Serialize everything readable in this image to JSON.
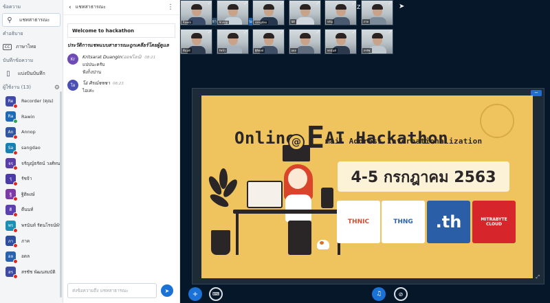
{
  "nav": {
    "section_messages": "ข้อความ",
    "public_chat": "แชทสาธารณะ",
    "section_captions": "คำอธิบาย",
    "language_thai": "ภาษาไทย",
    "section_notes": "บันทึกข้อความ",
    "shared_notes": "แบ่งปันบันทึก",
    "section_users": "ผู้ใช้งาน (13)"
  },
  "users": [
    {
      "initials": "Re",
      "name": "Recorder (คุณ)",
      "color": "#3e49a8",
      "status": "red"
    },
    {
      "initials": "Ra",
      "name": "Rawin",
      "color": "#1c6ab8",
      "status": "green"
    },
    {
      "initials": "An",
      "name": "Annop",
      "color": "#2f55a3",
      "status": "red"
    },
    {
      "initials": "Sa",
      "name": "sangdao",
      "color": "#1680b3",
      "status": "red"
    },
    {
      "initials": "จร",
      "name": "จรัญญ์ธรัตน์ วงศ์ทนท์...",
      "color": "#5a3ea8",
      "status": "red"
    },
    {
      "initials": "รุ",
      "name": "รัชจ้า",
      "color": "#4c3aa6",
      "status": "red"
    },
    {
      "initials": "ฐิ",
      "name": "ฐิติพงษ์",
      "color": "#7b3aa6",
      "status": "red"
    },
    {
      "initials": "ดิ",
      "name": "ดีนนท์",
      "color": "#5c3fb0",
      "status": "red"
    },
    {
      "initials": "พร",
      "name": "พรนันท์ รัตนโรจน์พันธ์",
      "color": "#1c8fb5",
      "status": "red"
    },
    {
      "initials": "ภา",
      "name": "ภาค",
      "color": "#2d4e9e",
      "status": "red"
    },
    {
      "initials": "อล",
      "name": "อดล",
      "color": "#2863b0",
      "status": "red"
    },
    {
      "initials": "สร",
      "name": "สรชัช พัฒนสมบัติ",
      "color": "#3c4aa1",
      "status": "red"
    }
  ],
  "chat": {
    "header": "แชทสาธารณะ",
    "welcome": "Welcome to hackathon",
    "announcement": "ประวัติการแชทแบบสาธารณะถูกเคลียร์โดยผู้ดูแล",
    "messages": [
      {
        "initials": "Kr",
        "avatar_color": "#6f4bb5",
        "name": "Kritsarat Duangin",
        "sub": "(ออฟไลน์)",
        "time": "08:21",
        "lines": [
          "แปปนะครับ",
          "ฟังก็งปาน"
        ]
      },
      {
        "initials": "โอ",
        "avatar_color": "#4a4fb3",
        "name": "โอ่ ศิรณ์ชชชา",
        "sub": "",
        "time": "08:23",
        "lines": [
          "ไอเค่ะ"
        ]
      }
    ],
    "input_placeholder": "ส่งข้อความถึง แชทสาธารณะ",
    "send_icon": "➤"
  },
  "main": {
    "title": "JZDSbN",
    "presenters": [
      {
        "name": "โอ่ ศิรณ์ชชชา",
        "active": false
      },
      {
        "name": "สรชัช พัฒนสมบัติ",
        "active": true
      }
    ],
    "videos": [
      {
        "label": "Rawin"
      },
      {
        "label": "Annop"
      },
      {
        "label": "sangdao"
      },
      {
        "label": "นิติ"
      },
      {
        "label": "จรัญ"
      },
      {
        "label": "ภาค"
      },
      {
        "label": "ดีนนท์"
      },
      {
        "label": "รัชจ้า"
      },
      {
        "label": "ฐิติพงษ์"
      },
      {
        "label": "อดล"
      },
      {
        "label": "พรนันท์"
      },
      {
        "label": "สรชัช"
      }
    ]
  },
  "slide": {
    "title_pre": "Online ",
    "title_E": "E",
    "title_post": "AI Hackathon",
    "subtitle": "mail Address Internationalization",
    "date": "4-5 กรกฎาคม 2563",
    "logos": [
      {
        "text": "THNIC",
        "bg": "#ffffff",
        "color": "#e0482f"
      },
      {
        "text": "THNG",
        "bg": "#ffffff",
        "color": "#2a62b0"
      },
      {
        "text": ".th",
        "bg": "#2a5fa8",
        "color": "#ffffff"
      },
      {
        "text": "MITRABYTE CLOUD",
        "bg": "#d6262b",
        "color": "#ffffff"
      }
    ]
  }
}
